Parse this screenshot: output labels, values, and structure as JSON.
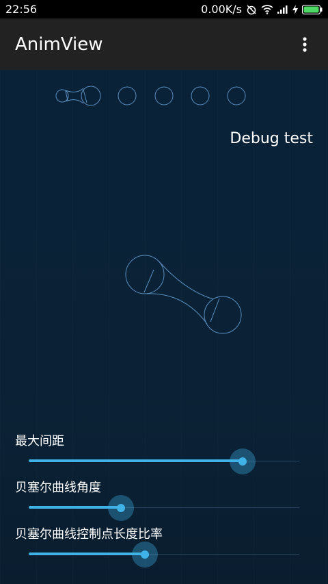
{
  "status_bar": {
    "time": "22:56",
    "speed": "0.00K/s",
    "icons": [
      "alarm-off-icon",
      "wifi-icon",
      "signal-icon",
      "charging-icon",
      "battery-icon"
    ]
  },
  "app_bar": {
    "title": "AnimView",
    "overflow_icon": "more-vert-icon"
  },
  "main": {
    "debug_label": "Debug test"
  },
  "sliders": [
    {
      "label": "最大间距",
      "value": 0.79
    },
    {
      "label": "贝塞尔曲线角度",
      "value": 0.34
    },
    {
      "label": "贝塞尔曲线控制点长度比率",
      "value": 0.43
    }
  ],
  "colors": {
    "accent": "#3fb3e8",
    "background": "#0b2236",
    "app_bar": "#222222",
    "outline": "#5a8fc0"
  }
}
